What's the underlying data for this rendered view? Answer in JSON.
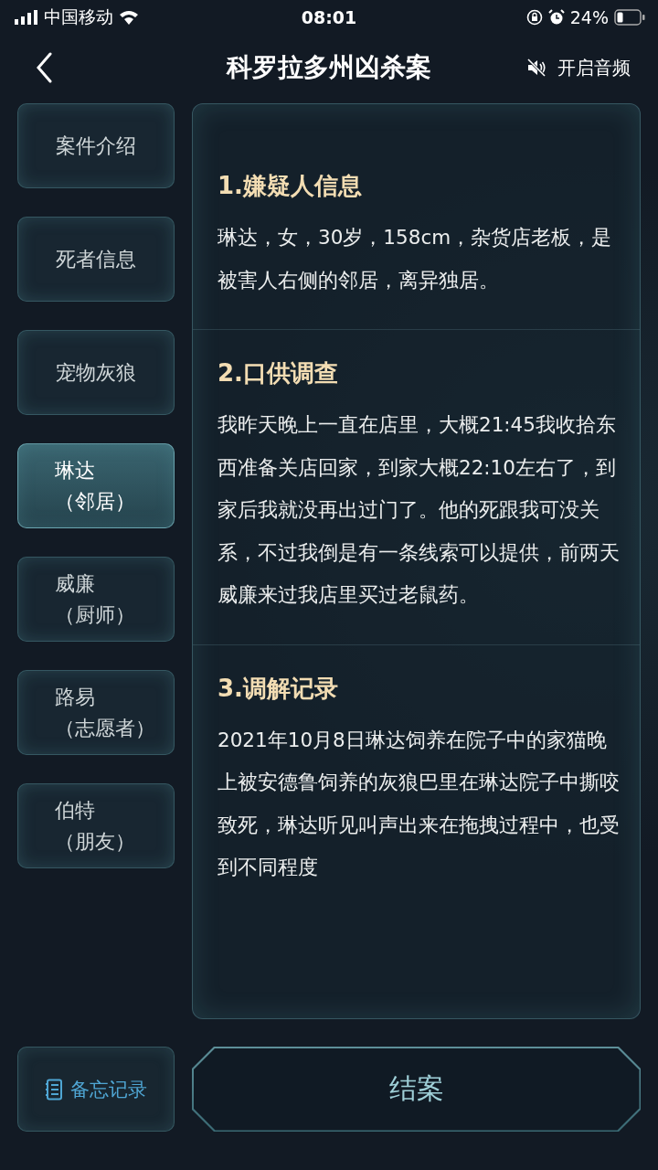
{
  "status_bar": {
    "carrier": "中国移动",
    "time": "08:01",
    "battery": "24%"
  },
  "header": {
    "title": "科罗拉多州凶杀案",
    "audio_label": "开启音频"
  },
  "sidebar": {
    "items": [
      {
        "lines": [
          "案件介绍"
        ],
        "selected": false
      },
      {
        "lines": [
          "死者信息"
        ],
        "selected": false
      },
      {
        "lines": [
          "宠物灰狼"
        ],
        "selected": false
      },
      {
        "lines": [
          "琳达",
          "（邻居）"
        ],
        "selected": true
      },
      {
        "lines": [
          "威廉",
          "（厨师）"
        ],
        "selected": false
      },
      {
        "lines": [
          "路易",
          "（志愿者）"
        ],
        "selected": false
      },
      {
        "lines": [
          "伯特",
          "（朋友）"
        ],
        "selected": false
      }
    ]
  },
  "sections": [
    {
      "title": "1.嫌疑人信息",
      "text": "琳达，女，30岁，158cm，杂货店老板，是被害人右侧的邻居，离异独居。"
    },
    {
      "title": "2.口供调查",
      "text": "我昨天晚上一直在店里，大概21:45我收拾东西准备关店回家，到家大概22:10左右了，到家后我就没再出过门了。他的死跟我可没关系，不过我倒是有一条线索可以提供，前两天威廉来过我店里买过老鼠药。"
    },
    {
      "title": "3.调解记录",
      "text": "2021年10月8日琳达饲养在院子中的家猫晚上被安德鲁饲养的灰狼巴里在琳达院子中撕咬致死，琳达听见叫声出来在拖拽过程中，也受到不同程度"
    }
  ],
  "footer": {
    "memo_label": "备忘记录",
    "close_case_label": "结案"
  }
}
